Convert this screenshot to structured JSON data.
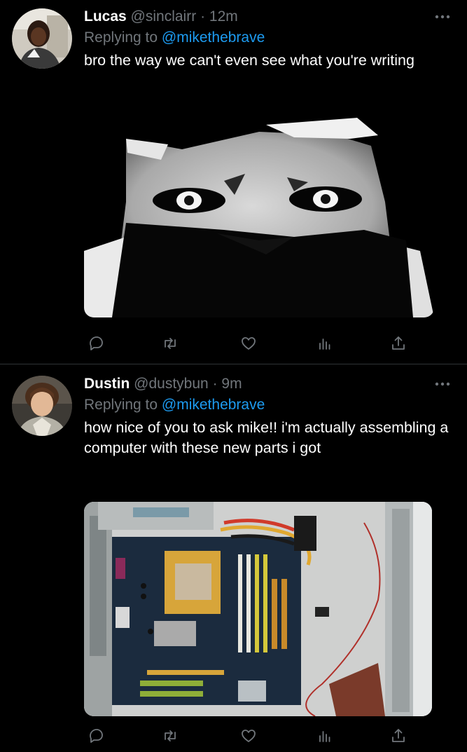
{
  "tweets": [
    {
      "name": "Lucas",
      "handle": "@sinclairr",
      "separator": "·",
      "time": "12m",
      "replying_prefix": "Replying to",
      "replying_to": "@mikethebrave",
      "text": "bro the way we can't even see what you're writing",
      "media_subject": "dark grainy cat face meme"
    },
    {
      "name": "Dustin",
      "handle": "@dustybun",
      "separator": "·",
      "time": "9m",
      "replying_prefix": "Replying to",
      "replying_to": "@mikethebrave",
      "text": "how nice of you to ask mike!! i'm actually assembling a computer with these new parts i got",
      "media_subject": "computer case with motherboard installed"
    }
  ],
  "icons": {
    "more": "more-horizontal-icon",
    "reply": "reply-icon",
    "retweet": "retweet-icon",
    "like": "heart-icon",
    "views": "views-icon",
    "share": "share-icon"
  },
  "colors": {
    "background": "#000000",
    "secondary_text": "#71767b",
    "mention": "#1d9bf0",
    "divider": "#2f3336"
  }
}
